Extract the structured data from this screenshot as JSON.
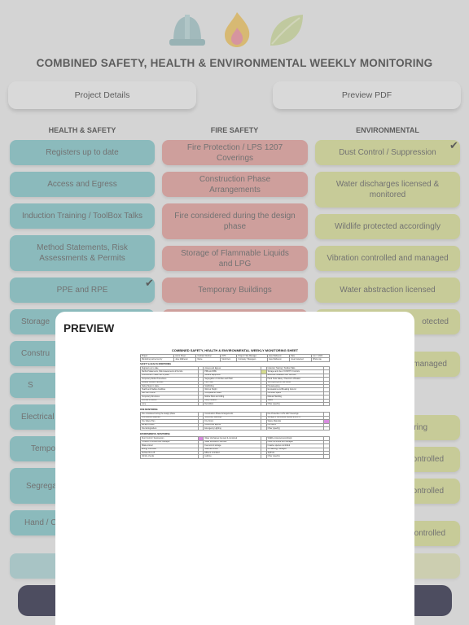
{
  "app": {
    "title": "COMBINED SAFETY, HEALTH & ENVIRONMENTAL WEEKLY MONITORING",
    "icons": [
      "hard-hat-icon",
      "flame-icon",
      "leaf-icon"
    ],
    "buttons": {
      "project_details": "Project Details",
      "preview_pdf": "Preview PDF"
    }
  },
  "columns": {
    "health_safety": {
      "heading": "HEALTH & SAFETY",
      "color": "#7cc3c6",
      "items": [
        "Registers up to date",
        "Access and Egress",
        "Induction Training / ToolBox Talks",
        "Method Statements, Risk Assessments & Permits",
        "PPE and RPE",
        "Storage",
        "Constru",
        "S",
        "Electrical",
        "Tempo",
        "Segrega",
        "Hand / C"
      ]
    },
    "fire_safety": {
      "heading": "FIRE SAFETY",
      "color": "#e29a96",
      "items": [
        "Fire Protection / LPS 1207 Coverings",
        "Construction Phase Arrangements",
        "Fire considered during the design phase",
        "Storage of Flammable Liquids and LPG",
        "Temporary Buildings"
      ]
    },
    "environmental": {
      "heading": "ENVIRONMENTAL",
      "color": "#d7dd8f",
      "items": [
        "Dust Control / Suppression",
        "Water discharges licensed & monitored",
        "Wildlife protected accordingly",
        "Vibration controlled and managed",
        "Water abstraction licensed",
        "otected",
        "& managed",
        "toring",
        "controlled",
        "controlled",
        "ontrolled"
      ]
    }
  },
  "preview": {
    "title": "PREVIEW",
    "sheet": {
      "title": "COMBINED SAFETY, HEALTH & ENVIRONMENTAL WEEKLY MONITORING SHEET",
      "header_rows": [
        [
          "Project",
          "Acorn Street",
          "Contract Number",
          "2476",
          "Project / Site Manager",
          "Jane Matheson",
          "Date",
          "Jun 7, 2024"
        ],
        [
          "Monitoring carried out by",
          "Jane Matheson",
          "Name",
          "Stock Item",
          "Company / Managers",
          "Jane Matheson",
          "Area Inspected",
          "Whole site"
        ]
      ],
      "sections": [
        {
          "name": "SAFETY & HEALTH MONITORING",
          "rows": [
            [
              "Registers up to date",
              "Access and Egress",
              "Induction Training / Toolbox Talks"
            ],
            [
              "Method Statements, Risk Assessments & Permits",
              "PPE and RPE",
              "Storage and Use of COSHH / Controls"
            ],
            [
              "Construction Phase Plan in place",
              "Welfare Equipment",
              "Electrical Installation and Services"
            ],
            [
              "Temporary Works Procedures",
              "Segregation of Vehicles and Plant",
              "Hand Tools Safety / Hand Arm Vibration"
            ],
            [
              "Suitable Welfare Facilities",
              "Hard Hats",
              "Site Lighting and Site Areas"
            ],
            [
              "Safety Signs in place",
              "Scaffolding",
              "Housekeeping"
            ],
            [
              "Health and Welfare Facilities",
              "Work at Height",
              "Excavations and Breaking Ground"
            ],
            [
              "Site Use Control",
              "Occupational Health",
              "Confined Space"
            ],
            [
              "Temporary Structures",
              "Mobile Plant and Lifting",
              "Manual Handling"
            ],
            [
              "First Aid Provision",
              "Utility Location",
              "Waste"
            ],
            [
              "Lone",
              "Demolition",
              "Other (specify)"
            ]
          ]
        },
        {
          "name": "FIRE MONITORING",
          "rows": [
            [
              "Fire considered during the design phase",
              "Construction Phase Arrangements",
              "Fire Protection / LPS 1207 Coverings"
            ],
            [
              "Combustible Materials",
              "Temporary Buildings",
              "Storage of Flammable Liquids and LPG"
            ],
            [
              "Fire Safety Plan",
              "Fire Doors",
              "Waste Materials"
            ],
            [
              "Escape Routes",
              "Access and Egress",
              "Fire Alarm"
            ],
            [
              "Fire Extinguishers",
              "Emergency Lighting",
              "Other (specify)"
            ]
          ]
        },
        {
          "name": "ENVIRONMENTAL MONITORING",
          "rows": [
            [
              "Dust Control / Suppression",
              "Water discharges licensed & monitored",
              "Wildlife protected accordingly"
            ],
            [
              "Vibration controlled and managed",
              "Water abstraction licensed",
              "Noise controlled and managed"
            ],
            [
              "Waste stored",
              "Fuel and oil storage",
              "Invasive species controlled"
            ],
            [
              "Energy controlled",
              "Materials stored",
              "Archaeology managed"
            ],
            [
              "Surface Run-off",
              "Effluent controlled",
              "Spill kits"
            ],
            [
              "Vehicle checks",
              "Lighting",
              "Other (specify)"
            ]
          ]
        }
      ]
    }
  }
}
